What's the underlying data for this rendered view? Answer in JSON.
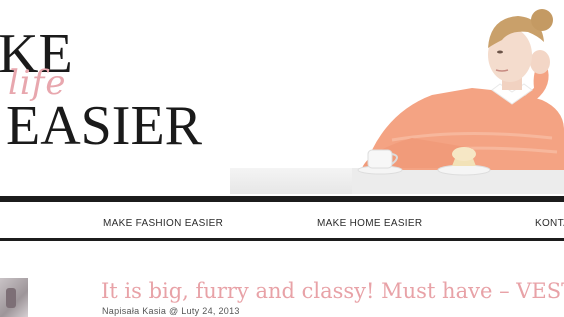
{
  "logo": {
    "line1": "KE",
    "script": "life",
    "line2": "EASIER"
  },
  "nav": {
    "items": [
      {
        "label": "MAKE FASHION EASIER"
      },
      {
        "label": "MAKE HOME EASIER"
      },
      {
        "label": "KONTA"
      }
    ]
  },
  "post": {
    "title": "It is big, furry and classy! Must have – VEST",
    "meta": "Napisała Kasia @ Luty 24, 2013"
  },
  "colors": {
    "accent_pink": "#e8a2a7",
    "rule_black": "#1c1c1c",
    "sweater_peach": "#f4a383"
  }
}
